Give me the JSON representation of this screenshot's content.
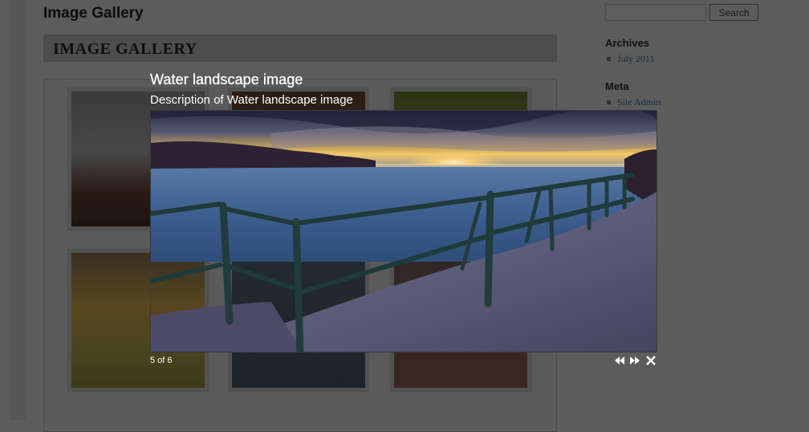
{
  "site": {
    "title": "Image Gallery"
  },
  "page": {
    "heading": "IMAGE GALLERY"
  },
  "search": {
    "placeholder": "",
    "button_label": "Search"
  },
  "sidebar": {
    "archives_title": "Archives",
    "archives_items": [
      "July 2011"
    ],
    "meta_title": "Meta",
    "meta_items": [
      "Site Admin"
    ]
  },
  "lightbox": {
    "title": "Water landscape image",
    "description": "Description of Water landscape image",
    "counter": "5 of 6",
    "controls": {
      "prev_icon": "rewind-icon",
      "next_icon": "fast-forward-icon",
      "close_icon": "close-icon"
    }
  },
  "colors": {
    "overlay": "#5c5c5c",
    "text_light": "#ffffff"
  }
}
